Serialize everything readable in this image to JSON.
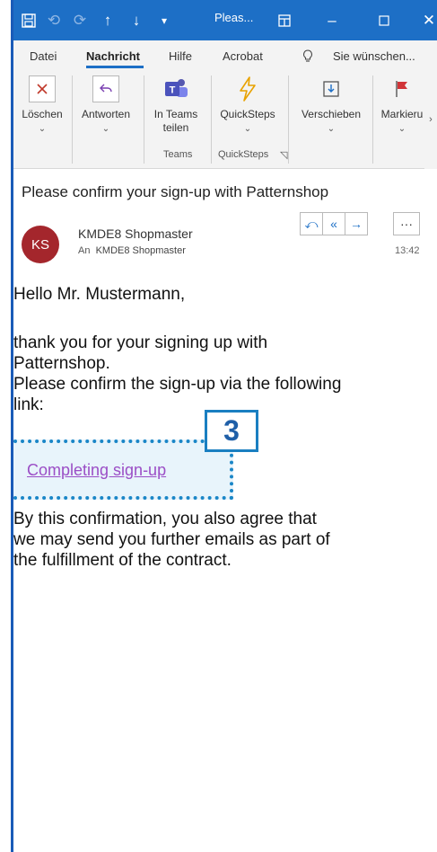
{
  "titlebar": {
    "title": "Pleas...",
    "colors": {
      "bar": "#1d6fc6"
    }
  },
  "tabs": [
    {
      "label": "Datei"
    },
    {
      "label": "Nachricht"
    },
    {
      "label": "Hilfe"
    },
    {
      "label": "Acrobat"
    },
    {
      "label": "Sie wünschen..."
    }
  ],
  "ribbon": {
    "delete": {
      "label": "Löschen",
      "icon": "close-icon"
    },
    "reply": {
      "label": "Antworten",
      "icon": "reply-icon"
    },
    "teams": {
      "label1": "In Teams",
      "label2": "teilen",
      "icon": "teams-icon"
    },
    "quicksteps": {
      "label": "QuickSteps",
      "icon": "lightning-icon"
    },
    "move": {
      "label": "Verschieben",
      "icon": "move-icon"
    },
    "flag": {
      "label": "Markieru",
      "icon": "flag-icon"
    },
    "groups": {
      "teams": "Teams",
      "quicksteps": "QuickSteps"
    }
  },
  "message": {
    "subject": "Please confirm your sign-up with Patternshop",
    "avatar_initials": "KS",
    "sender": "KMDE8 Shopmaster",
    "to_label": "An",
    "to_name": "KMDE8 Shopmaster",
    "time": "13:42"
  },
  "body": {
    "greeting": "Hello Mr. Mustermann,",
    "line1": "thank you for your signing up with",
    "line2": "Patternshop.",
    "line3": "Please confirm the sign-up via the following",
    "line4": "link:",
    "link_text": "Completing sign-up",
    "line5": "By this confirmation, you also agree that",
    "line6": "we may send you further emails as part of",
    "line7": "the fulfillment of the contract."
  },
  "callout": {
    "number": "3"
  }
}
